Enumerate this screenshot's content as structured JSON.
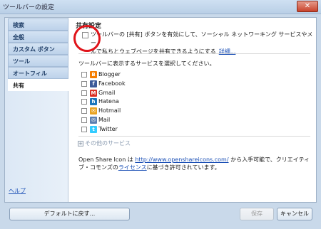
{
  "window": {
    "title": "ツールバーの設定",
    "close_label": "✕"
  },
  "sidebar": {
    "items": [
      {
        "label": "検索"
      },
      {
        "label": "全般"
      },
      {
        "label": "カスタム ボタン"
      },
      {
        "label": "ツール"
      },
      {
        "label": "オートフィル"
      },
      {
        "label": "共有"
      }
    ],
    "help_label": "ヘルプ"
  },
  "main": {
    "section_title": "共有設定",
    "enable_text_line1": "ツールバーの [共有] ボタンを有効にして、ソーシャル ネットワーキング サービスやメー",
    "enable_text_line2": "ルで私ちとウェブページを共有できるようにする",
    "details_link": "詳細...",
    "list_heading": "ツールバーに表示するサービスを選択してください。",
    "services": [
      {
        "label": "Blogger",
        "icon": "blogger-icon",
        "color": "#f57d00",
        "glyph": "B"
      },
      {
        "label": "Facebook",
        "icon": "facebook-icon",
        "color": "#3b5998",
        "glyph": "f"
      },
      {
        "label": "Gmail",
        "icon": "gmail-icon",
        "color": "#d93025",
        "glyph": "M"
      },
      {
        "label": "Hatena",
        "icon": "hatena-icon",
        "color": "#1b75bb",
        "glyph": "h"
      },
      {
        "label": "Hotmail",
        "icon": "hotmail-icon",
        "color": "#e9a321",
        "glyph": "✉"
      },
      {
        "label": "Mail",
        "icon": "mail-icon",
        "color": "#5c7fb0",
        "glyph": "✉"
      },
      {
        "label": "Twitter",
        "icon": "twitter-icon",
        "color": "#33ccff",
        "glyph": "t"
      }
    ],
    "more_services_label": "その他のサービス",
    "credit_prefix": "Open Share Icon は ",
    "credit_url": "http://www.openshareicons.com/",
    "credit_mid": " から入手可能で、クリエイティ",
    "credit_line2_prefix": "ブ・コモンズの",
    "credit_license": "ライセンス",
    "credit_suffix": "に基づき許可されています。"
  },
  "footer": {
    "default_label": "デフォルトに戻す...",
    "save_label": "保存",
    "cancel_label": "キャンセル"
  },
  "colors": {
    "accent": "#1a4fb5",
    "highlight": "#e0141a"
  }
}
